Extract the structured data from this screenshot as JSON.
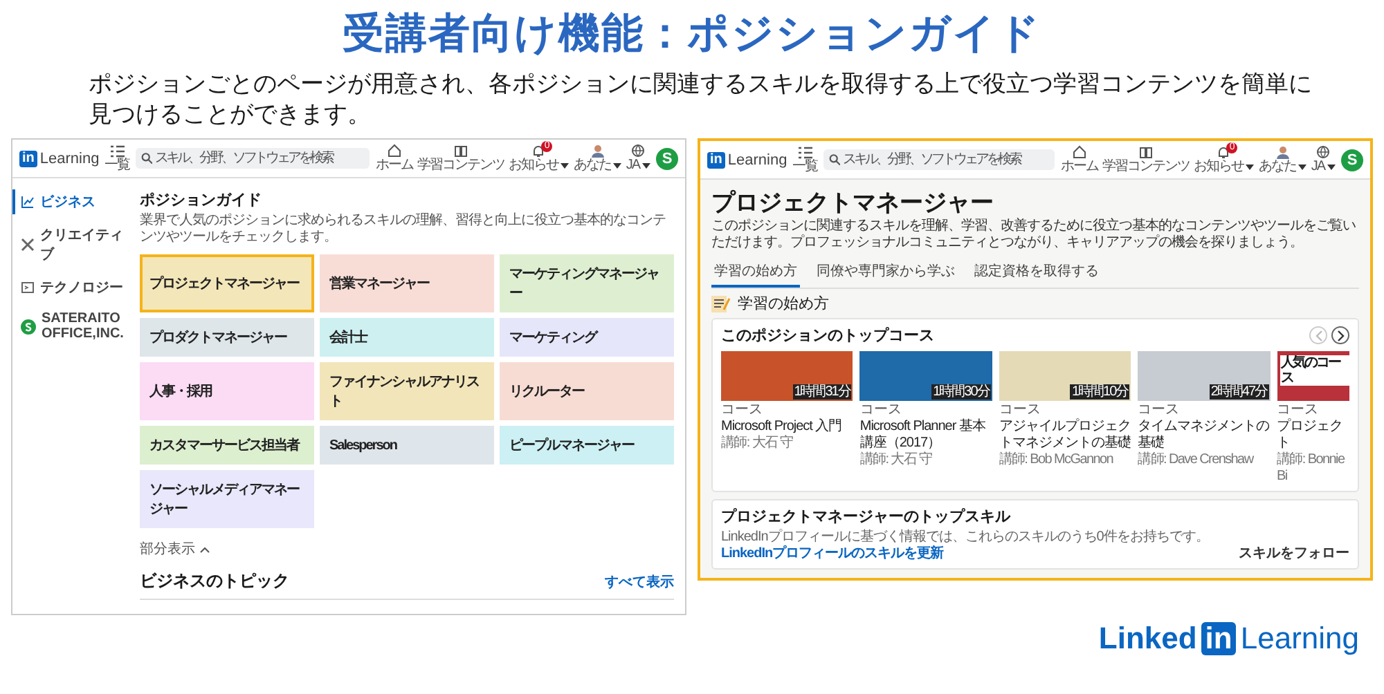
{
  "title": "受講者向け機能：ポジションガイド",
  "description": "ポジションごとのページが用意され、各ポジションに関連するスキルを取得する上で役立つ学習コンテンツを簡単に見つけることができます。",
  "screens": [
    {
      "kind": "guide",
      "highlighted": false,
      "nav": {
        "logo_mark": "in",
        "logo_word": "Learning",
        "menu_label": "一覧",
        "search_placeholder": "スキル、分野、ソフトウェアを検索",
        "org_initial": "S",
        "items": [
          {
            "label": "ホーム",
            "dropdown": false
          },
          {
            "label": "学習コンテンツ",
            "dropdown": false
          },
          {
            "label": "お知らせ",
            "badge": "0",
            "dropdown": true
          },
          {
            "label": "あなた",
            "dropdown": true
          },
          {
            "label": "JA",
            "dropdown": true
          }
        ]
      },
      "sidebar": [
        {
          "label": "ビジネス",
          "selected": true
        },
        {
          "label": "クリエイティブ",
          "selected": false
        },
        {
          "label": "テクノロジー",
          "selected": false
        },
        {
          "label": "SATERAITO OFFICE,INC.",
          "selected": false
        }
      ],
      "heading": "ポジションガイド",
      "subtitle": "業界で人気のポジションに求められるスキルの理解、習得と向上に役立つ基本的なコンテンツやツールをチェックします。",
      "tiles": [
        {
          "label": "プロジェクトマネージャー",
          "color": "#f3e6b8",
          "highlighted": true
        },
        {
          "label": "営業マネージャー",
          "color": "#f8ddd6",
          "highlighted": false
        },
        {
          "label": "マーケティングマネージャー",
          "color": "#ddefd0",
          "highlighted": false
        },
        {
          "label": "プロダクトマネージャー",
          "color": "#dee6ea",
          "highlighted": false
        },
        {
          "label": "会計士",
          "color": "#cef0f1",
          "highlighted": false
        },
        {
          "label": "マーケティング",
          "color": "#e6e6fa",
          "highlighted": false
        },
        {
          "label": "人事・採用",
          "color": "#fbdcf4",
          "highlighted": false
        },
        {
          "label": "ファイナンシャルアナリスト",
          "color": "#f2e5b9",
          "highlighted": false
        },
        {
          "label": "リクルーター",
          "color": "#f7dcd4",
          "highlighted": false
        },
        {
          "label": "カスタマーサービス担当者",
          "color": "#dcefcf",
          "highlighted": false
        },
        {
          "label": "Salesperson",
          "color": "#dfe6eb",
          "highlighted": false
        },
        {
          "label": "ピープルマネージャー",
          "color": "#ccf0f3",
          "highlighted": false
        },
        {
          "label": "ソーシャルメディアマネージャー",
          "color": "#e8e7fb",
          "highlighted": false
        }
      ],
      "collapse_link": "部分表示",
      "topics_heading": "ビジネスのトピック",
      "see_all": "すべて表示"
    },
    {
      "kind": "position",
      "highlighted": true,
      "nav": {
        "logo_mark": "in",
        "logo_word": "Learning",
        "menu_label": "一覧",
        "search_placeholder": "スキル、分野、ソフトウェアを検索",
        "org_initial": "S",
        "items": [
          {
            "label": "ホーム",
            "dropdown": false
          },
          {
            "label": "学習コンテンツ",
            "dropdown": false
          },
          {
            "label": "お知らせ",
            "badge": "0",
            "dropdown": true
          },
          {
            "label": "あなた",
            "dropdown": true
          },
          {
            "label": "JA",
            "dropdown": true
          }
        ]
      },
      "heading": "プロジェクトマネージャー",
      "subtitle": "このポジションに関連するスキルを理解、学習、改善するために役立つ基本的なコンテンツやツールをご覧いただけます。プロフェッショナルコミュニティとつながり、キャリアアップの機会を探りましょう。",
      "tabs": [
        {
          "label": "学習の始め方",
          "selected": true
        },
        {
          "label": "同僚や専門家から学ぶ",
          "selected": false
        },
        {
          "label": "認定資格を取得する",
          "selected": false
        }
      ],
      "section_heading": "学習の始め方",
      "courses_card": {
        "heading": "このポジションのトップコース",
        "arrows": [
          {
            "disabled": true
          },
          {
            "disabled": false
          }
        ],
        "courses": [
          {
            "type": "コース",
            "title": "Microsoft Project 入門",
            "author": "講師: 大石 守",
            "duration": "1時間31分"
          },
          {
            "type": "コース",
            "title": "Microsoft Planner 基本講座（2017）",
            "author": "講師: 大石 守",
            "duration": "1時間30分"
          },
          {
            "type": "コース",
            "title": "アジャイルプロジェクトマネジメントの基礎",
            "author": "講師: Bob McGannon",
            "duration": "1時間10分"
          },
          {
            "type": "コース",
            "title": "タイムマネジメントの基礎",
            "author": "講師: Dave Crenshaw",
            "duration": "2時間47分"
          },
          {
            "type": "コース",
            "title": "プロジェクト",
            "author": "講師: Bonnie Bi",
            "badge": "人気のコース"
          }
        ]
      },
      "skills_card": {
        "heading": "プロジェクトマネージャーのトップスキル",
        "text": "LinkedInプロフィールに基づく情報では、これらのスキルのうち0件をお持ちです。",
        "link": "LinkedInプロフィールのスキルを更新",
        "follow": "スキルをフォロー"
      }
    }
  ],
  "brand": {
    "word": "Linked",
    "mark": "in",
    "product": "Learning"
  }
}
